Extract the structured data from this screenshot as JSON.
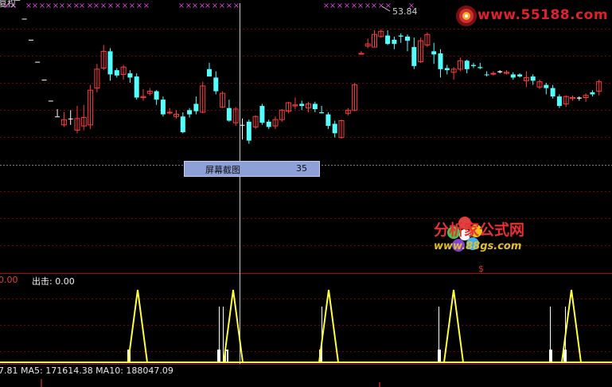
{
  "window": {
    "title": "复权"
  },
  "candles": [
    {
      "o": 144,
      "c": 144,
      "h": 144,
      "l": 144,
      "col": "w"
    },
    {
      "o": 129,
      "c": 129,
      "h": 129,
      "l": 129,
      "col": "w"
    },
    {
      "o": 111,
      "c": 111,
      "h": 111,
      "l": 111,
      "col": "w"
    },
    {
      "o": 91,
      "c": 91,
      "h": 91,
      "l": 91,
      "col": "w"
    },
    {
      "o": 70,
      "c": 70,
      "h": 70,
      "l": 70,
      "col": "w"
    },
    {
      "o": 53,
      "c": 53,
      "h": 53,
      "l": 53,
      "col": "w"
    },
    {
      "o": 33,
      "c": 33,
      "h": 33,
      "l": 33,
      "col": "w"
    },
    {
      "o": 18,
      "c": 18,
      "h": 25,
      "l": 18,
      "col": "w"
    },
    {
      "o": 10,
      "c": 15,
      "h": 22,
      "l": 8,
      "col": "r"
    },
    {
      "o": 16,
      "c": 16,
      "h": 24,
      "l": 10,
      "col": "w"
    },
    {
      "o": 5,
      "c": 16,
      "h": 28,
      "l": 2,
      "col": "r"
    },
    {
      "o": 9,
      "c": 17,
      "h": 29,
      "l": 5,
      "col": "r"
    },
    {
      "o": 43,
      "c": 10,
      "h": 48,
      "l": 6,
      "col": "r"
    },
    {
      "o": 45,
      "c": 63,
      "h": 68,
      "l": 41,
      "col": "r"
    },
    {
      "o": 64,
      "c": 80,
      "h": 86,
      "l": 62,
      "col": "r"
    },
    {
      "o": 80,
      "c": 58,
      "h": 83,
      "l": 52,
      "col": "c"
    },
    {
      "o": 57,
      "c": 62,
      "h": 64,
      "l": 55,
      "col": "c"
    },
    {
      "o": 65,
      "c": 58,
      "h": 67,
      "l": 53,
      "col": "r"
    },
    {
      "o": 59,
      "c": 55,
      "h": 62,
      "l": 50,
      "col": "c"
    },
    {
      "o": 56,
      "c": 36,
      "h": 59,
      "l": 34,
      "col": "c"
    },
    {
      "o": 36,
      "c": 37,
      "h": 44,
      "l": 33,
      "col": "r"
    },
    {
      "o": 40,
      "c": 42,
      "h": 45,
      "l": 38,
      "col": "r"
    },
    {
      "o": 42,
      "c": 34,
      "h": 43,
      "l": 29,
      "col": "c"
    },
    {
      "o": 34,
      "c": 20,
      "h": 37,
      "l": 18,
      "col": "c"
    },
    {
      "o": 22,
      "c": 22,
      "h": 26,
      "l": 20,
      "col": "r"
    },
    {
      "o": 20,
      "c": 18,
      "h": 24,
      "l": 16,
      "col": "r"
    },
    {
      "o": 18,
      "c": 3,
      "h": 22,
      "l": 2,
      "col": "c"
    },
    {
      "o": 20,
      "c": 24,
      "h": 26,
      "l": 17,
      "col": "c"
    },
    {
      "o": 23,
      "c": 30,
      "h": 37,
      "l": 20,
      "col": "c"
    },
    {
      "o": 22,
      "c": 47,
      "h": 51,
      "l": 21,
      "col": "r"
    },
    {
      "o": 63,
      "c": 56,
      "h": 69,
      "l": 56,
      "col": "c"
    },
    {
      "o": 55,
      "c": 42,
      "h": 61,
      "l": 39,
      "col": "c"
    },
    {
      "o": 40,
      "c": 27,
      "h": 42,
      "l": 26,
      "col": "r"
    },
    {
      "o": 26,
      "c": 14,
      "h": 34,
      "l": 13,
      "col": "c"
    },
    {
      "o": 12,
      "c": 25,
      "h": 27,
      "l": 9,
      "col": "r"
    },
    {
      "o": 10,
      "c": 10,
      "h": 16,
      "l": -4,
      "col": "w"
    },
    {
      "o": 13,
      "c": -5,
      "h": 15,
      "l": -8,
      "col": "c"
    },
    {
      "o": 8,
      "c": 18,
      "h": 19,
      "l": 6,
      "col": "r"
    },
    {
      "o": 28,
      "c": 12,
      "h": 30,
      "l": 10,
      "col": "c"
    },
    {
      "o": 13,
      "c": 8,
      "h": 15,
      "l": 6,
      "col": "c"
    },
    {
      "o": 9,
      "c": 15,
      "h": 18,
      "l": 6,
      "col": "r"
    },
    {
      "o": 15,
      "c": 24,
      "h": 25,
      "l": 13,
      "col": "r"
    },
    {
      "o": 23,
      "c": 31,
      "h": 32,
      "l": 21,
      "col": "r"
    },
    {
      "o": 29,
      "c": 28,
      "h": 36,
      "l": 25,
      "col": "r"
    },
    {
      "o": 28,
      "c": 30,
      "h": 33,
      "l": 24,
      "col": "c"
    },
    {
      "o": 30,
      "c": 26,
      "h": 32,
      "l": 22,
      "col": "r"
    },
    {
      "o": 30,
      "c": 25,
      "h": 32,
      "l": 22,
      "col": "c"
    },
    {
      "o": 21,
      "c": 22,
      "h": 28,
      "l": 21,
      "col": "c"
    },
    {
      "o": 20,
      "c": 9,
      "h": 22,
      "l": 6,
      "col": "c"
    },
    {
      "o": 11,
      "c": 2,
      "h": 14,
      "l": -2,
      "col": "c"
    },
    {
      "o": -2,
      "c": 14,
      "h": 15,
      "l": -3,
      "col": "r"
    },
    {
      "o": 21,
      "c": 24,
      "h": 26,
      "l": 19,
      "col": "r"
    },
    {
      "o": 24,
      "c": 48,
      "h": 50,
      "l": 23,
      "col": "r"
    },
    {
      "o": 78,
      "c": 78,
      "h": 80,
      "l": 77,
      "col": "r"
    },
    {
      "o": 85,
      "c": 87,
      "h": 92,
      "l": 83,
      "col": "r"
    },
    {
      "o": 84,
      "c": 96,
      "h": 100,
      "l": 84,
      "col": "r"
    },
    {
      "o": 94,
      "c": 99,
      "h": 101,
      "l": 93,
      "col": "r"
    },
    {
      "o": 95,
      "c": 87,
      "h": 100,
      "l": 86,
      "col": "c"
    },
    {
      "o": 87,
      "c": 91,
      "h": 94,
      "l": 82,
      "col": "c"
    },
    {
      "o": 94,
      "c": 95,
      "h": 97,
      "l": 88,
      "col": "c"
    },
    {
      "o": 94,
      "c": 90,
      "h": 96,
      "l": 80,
      "col": "c"
    },
    {
      "o": 84,
      "c": 66,
      "h": 93,
      "l": 63,
      "col": "c"
    },
    {
      "o": 70,
      "c": 90,
      "h": 93,
      "l": 69,
      "col": "r"
    },
    {
      "o": 86,
      "c": 96,
      "h": 98,
      "l": 84,
      "col": "r"
    },
    {
      "o": 80,
      "c": 77,
      "h": 88,
      "l": 68,
      "col": "c"
    },
    {
      "o": 78,
      "c": 63,
      "h": 82,
      "l": 55,
      "col": "c"
    },
    {
      "o": 64,
      "c": 62,
      "h": 67,
      "l": 58,
      "col": "c"
    },
    {
      "o": 63,
      "c": 60,
      "h": 65,
      "l": 53,
      "col": "r"
    },
    {
      "o": 63,
      "c": 71,
      "h": 74,
      "l": 61,
      "col": "r"
    },
    {
      "o": 71,
      "c": 63,
      "h": 72,
      "l": 59,
      "col": "c"
    },
    {
      "o": 67,
      "c": 66,
      "h": 69,
      "l": 64,
      "col": "c"
    },
    {
      "o": 64,
      "c": 65,
      "h": 69,
      "l": 63,
      "col": "c"
    },
    {
      "o": 58,
      "c": 58,
      "h": 61,
      "l": 56,
      "col": "c"
    },
    {
      "o": 59,
      "c": 59,
      "h": 61,
      "l": 57,
      "col": "r"
    },
    {
      "o": 60,
      "c": 61,
      "h": 62,
      "l": 59,
      "col": "w"
    },
    {
      "o": 60,
      "c": 59,
      "h": 62,
      "l": 58,
      "col": "r"
    },
    {
      "o": 58,
      "c": 55,
      "h": 60,
      "l": 53,
      "col": "c"
    },
    {
      "o": 58,
      "c": 56,
      "h": 59,
      "l": 55,
      "col": "c"
    },
    {
      "o": 55,
      "c": 52,
      "h": 61,
      "l": 46,
      "col": "r"
    },
    {
      "o": 56,
      "c": 52,
      "h": 58,
      "l": 48,
      "col": "c"
    },
    {
      "o": 51,
      "c": 46,
      "h": 53,
      "l": 44,
      "col": "r"
    },
    {
      "o": 48,
      "c": 45,
      "h": 50,
      "l": 39,
      "col": "c"
    },
    {
      "o": 45,
      "c": 37,
      "h": 48,
      "l": 35,
      "col": "c"
    },
    {
      "o": 37,
      "c": 28,
      "h": 39,
      "l": 26,
      "col": "c"
    },
    {
      "o": 30,
      "c": 37,
      "h": 38,
      "l": 27,
      "col": "r"
    },
    {
      "o": 35,
      "c": 36,
      "h": 38,
      "l": 33,
      "col": "r"
    },
    {
      "o": 35,
      "c": 36,
      "h": 37,
      "l": 33,
      "col": "w"
    },
    {
      "o": 36,
      "c": 38,
      "h": 40,
      "l": 32,
      "col": "r"
    },
    {
      "o": 41,
      "c": 39,
      "h": 43,
      "l": 37,
      "col": "c"
    },
    {
      "o": 42,
      "c": 51,
      "h": 53,
      "l": 38,
      "col": "r"
    }
  ],
  "x_markers": [
    "×",
    "×",
    "×",
    "×",
    "×",
    "×",
    "×",
    "×",
    "×",
    "×",
    "×",
    "×",
    "×",
    "×",
    "×",
    "×",
    "×",
    "×",
    "×",
    "×",
    "×",
    "×",
    "×",
    "×",
    "×",
    "×",
    "×",
    "×",
    "×",
    "×",
    "×",
    "×",
    "×",
    "×",
    "×",
    "×",
    "×",
    "×",
    "×",
    "×"
  ],
  "price_annotation": "53.84",
  "tooltip": {
    "label": "屏幕截图",
    "value": "35"
  },
  "site_logo": {
    "url_text": "www.55188.com"
  },
  "watermark": {
    "title": "分析家公式网",
    "url": "www.88gs.com"
  },
  "indicator": {
    "value_text": "0.00",
    "label_text": "出击: 0.00",
    "spikes": [
      173,
      293,
      413,
      570,
      718
    ],
    "white_bars": [
      160,
      164,
      273,
      277,
      282,
      287,
      401,
      404,
      550,
      554,
      690,
      694,
      708,
      712
    ]
  },
  "ma_line": "7.81  MA5: 171614.38  MA10: 188047.09",
  "dollar_marker": "$",
  "colors": {
    "background": "#000000",
    "up_candle": "#ff3b3b",
    "down_candle": "#54ffff",
    "flat_candle": "#ffffff",
    "grid_red": "#7a0000",
    "divider_red": "#c00000",
    "indicator_yellow": "#ffff40",
    "x_marker_magenta": "#e040e0",
    "crosshair": "#c8c8c8"
  }
}
